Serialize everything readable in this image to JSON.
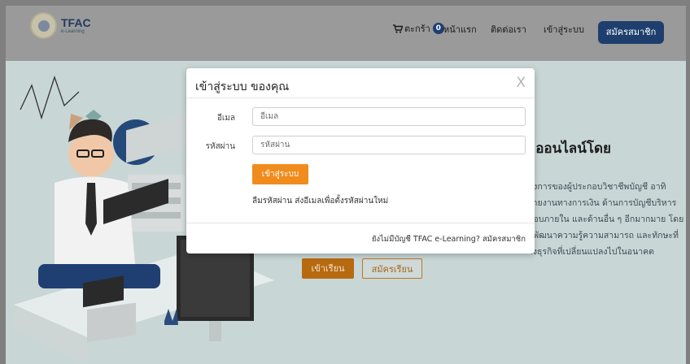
{
  "header": {
    "logo": {
      "name": "TFAC",
      "sub": "e-Learning"
    },
    "cart": {
      "label": "ตะกร้า",
      "count": "0"
    },
    "nav": {
      "home": "หน้าแรก",
      "contact": "ติดต่อเรา",
      "login": "เข้าสู่ระบบ",
      "signup": "สมัครสมาชิก"
    }
  },
  "hero": {
    "title": "มออนไลน์โดย",
    "body": [
      "องการของผู้ประกอบวิชาชีพบัญชี อาทิ",
      "รายงานทางการเงิน ด้านการบัญชีบริหาร",
      "สอบภายใน และด้านอื่น ๆ อีกมากมาย โดย",
      "อพัฒนาความรู้ความสามารถ และทักษะที่",
      "างธุรกิจที่เปลี่ยนแปลงไปในอนาคต"
    ],
    "enroll_button": "เข้าเรียน",
    "register_button": "สมัครเรียน"
  },
  "modal": {
    "title": "เข้าสู่ระบบ ของคุณ",
    "close": "X",
    "email": {
      "label": "อีเมล",
      "placeholder": "อีเมล",
      "value": ""
    },
    "password": {
      "label": "รหัสผ่าน",
      "placeholder": "รหัสผ่าน",
      "value": ""
    },
    "login_button": "เข้าสู่ระบบ",
    "forgot_text": "ลืมรหัสผ่าน ส่งอีเมลเพื่อตั้งรหัสผ่านใหม่",
    "footer_text": "ยังไม่มีบัญชี TFAC e-Learning? สมัครสมาชิก"
  },
  "colors": {
    "overlay": "#7f7f7f",
    "page_bg": "#c9d6d6",
    "header_bg": "#9a9a9a",
    "brand_navy": "#1e3f6e",
    "accent_orange": "#f08c1c",
    "dim_orange": "#b76a10"
  },
  "icons": {
    "cart": "cart-icon",
    "close": "close-icon",
    "logo": "logo-emblem"
  }
}
